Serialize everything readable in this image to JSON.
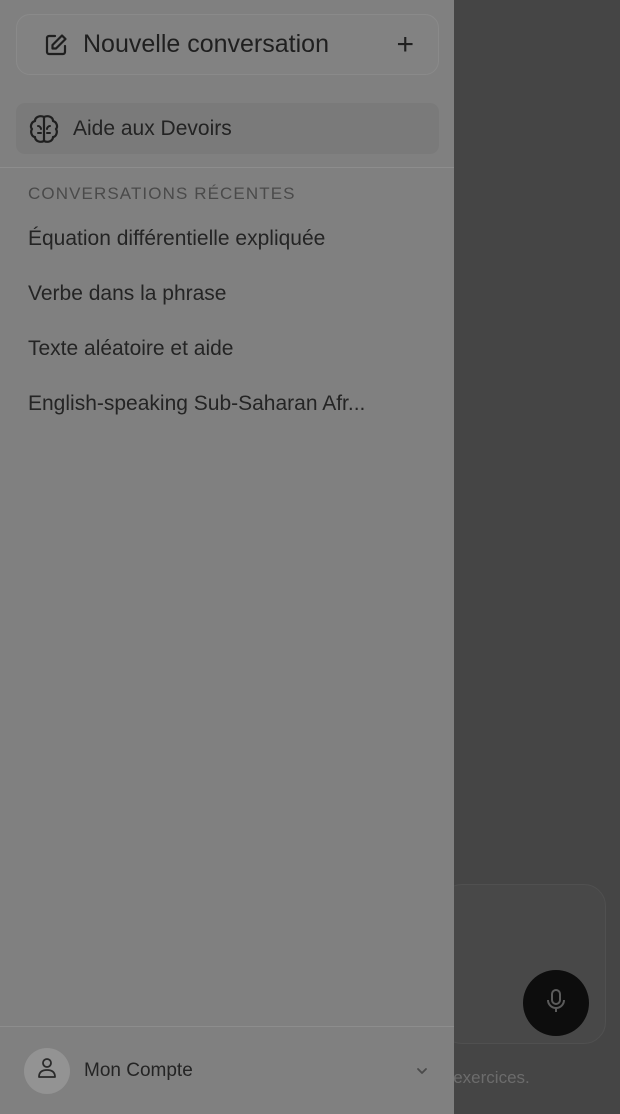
{
  "sidebar": {
    "new_chat_label": "Nouvelle conversation",
    "featured_item_label": "Aide aux Devoirs",
    "recent_section_title": "CONVERSATIONS RÉCENTES",
    "recent_conversations": [
      "Équation différentielle expliquée",
      "Verbe dans la phrase",
      "Texte aléatoire et aide",
      "English-speaking Sub-Saharan Afr..."
    ],
    "account_label": "Mon Compte"
  },
  "main": {
    "footer_hint_fragment": "s exercices."
  },
  "icons": {
    "new_chat": "edit-icon",
    "add": "plus-icon",
    "featured": "brain-icon",
    "account": "user-icon",
    "account_menu": "chevron-down-icon",
    "voice": "microphone-icon"
  },
  "colors": {
    "overlay_dark": "#454545",
    "sidebar_bg": "#808080",
    "selected_item_bg": "#7a7a7a",
    "mic_button_bg": "#0d0d0d"
  }
}
